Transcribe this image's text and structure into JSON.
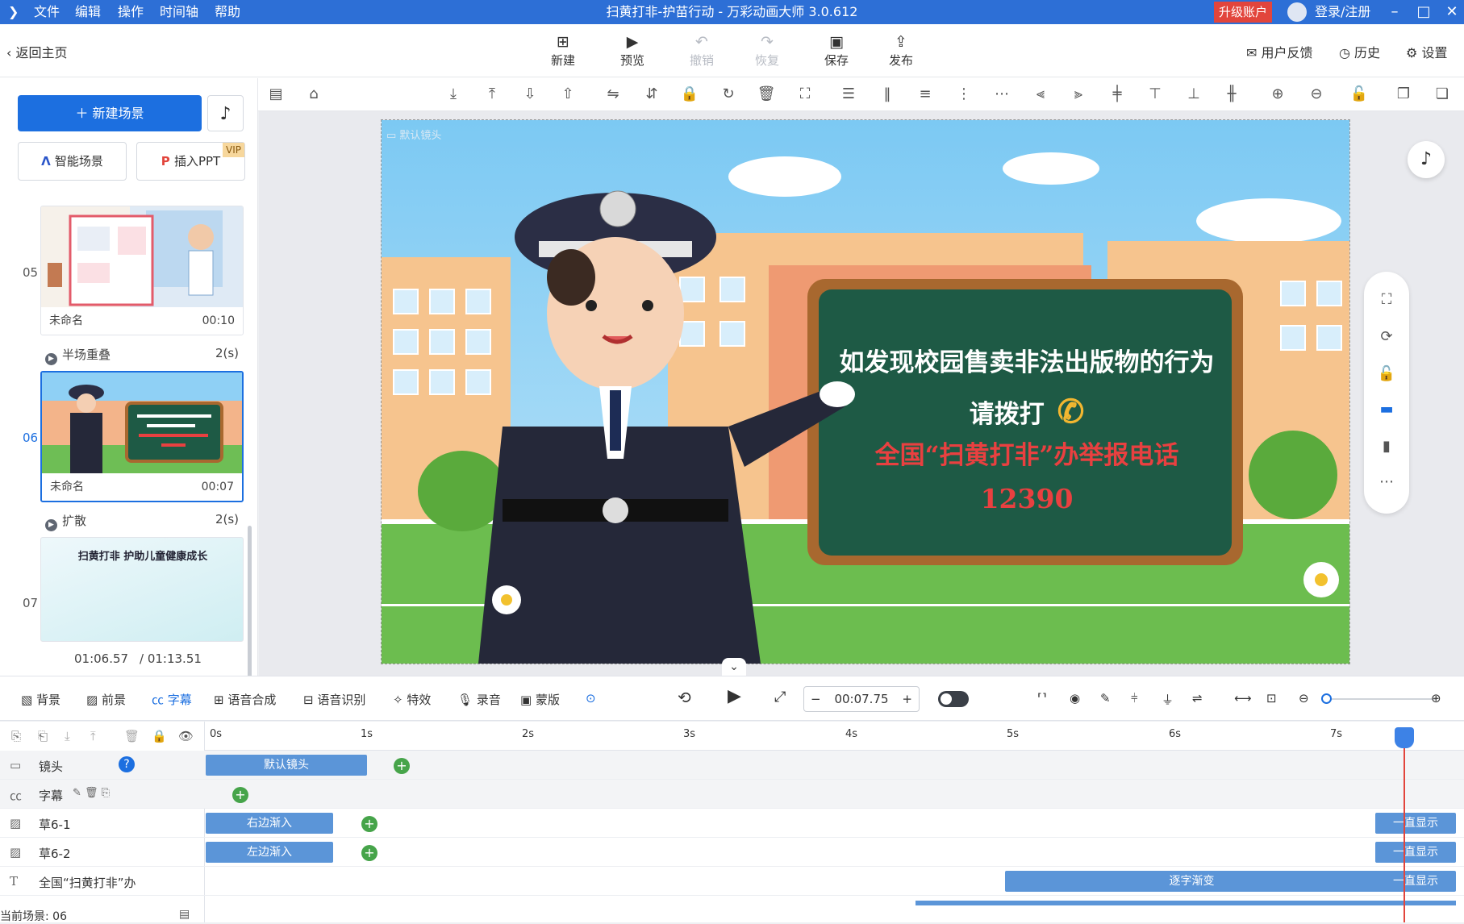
{
  "app": {
    "title": "扫黄打非-护苗行动 - 万彩动画大师 3.0.612",
    "menu": [
      "文件",
      "编辑",
      "操作",
      "时间轴",
      "帮助"
    ],
    "upgrade": "升级账户",
    "login": "登录/注册"
  },
  "toolbar": {
    "back": "返回主页",
    "new": "新建",
    "preview": "预览",
    "undo": "撤销",
    "redo": "恢复",
    "save": "保存",
    "publish": "发布",
    "feedback": "用户反馈",
    "history": "历史",
    "settings": "设置"
  },
  "left": {
    "new_scene": "新建场景",
    "smart_scene": "智能场景",
    "insert_ppt": "插入PPT",
    "vip": "VIP",
    "scenes": [
      {
        "num": "05",
        "name": "未命名",
        "duration": "00:10"
      },
      {
        "num": "06",
        "name": "未命名",
        "duration": "00:07"
      },
      {
        "num": "07",
        "name": "",
        "duration": ""
      }
    ],
    "transitions": [
      {
        "name": "半场重叠",
        "duration": "2(s)"
      },
      {
        "name": "扩散",
        "duration": "2(s)"
      }
    ],
    "scene7_title": "扫黄打非 护助儿童健康成长",
    "current_time": "01:06.57",
    "total_time": "/ 01:13.51"
  },
  "stage": {
    "camera_label": "默认镜头",
    "board_line1": "如发现校园售卖非法出版物的行为",
    "board_line2": "请拨打",
    "board_line3": "全国“扫黄打非”办举报电话",
    "board_line4": "12390"
  },
  "bottom": {
    "tabs": [
      "背景",
      "前景",
      "字幕",
      "语音合成",
      "语音识别",
      "特效",
      "录音",
      "蒙版"
    ],
    "active_tab": "字幕",
    "time": "00:07.75"
  },
  "timeline": {
    "ticks": [
      "0s",
      "1s",
      "2s",
      "3s",
      "4s",
      "5s",
      "6s",
      "7s"
    ],
    "rows": [
      {
        "label": "镜头",
        "clip": "默认镜头"
      },
      {
        "label": "字幕",
        "clip": ""
      },
      {
        "label": "草6-1",
        "clip": "右边渐入",
        "end_clip": "一直显示"
      },
      {
        "label": "草6-2",
        "clip": "左边渐入",
        "end_clip": "一直显示"
      },
      {
        "label": "全国“扫黄打非”办",
        "clip": "逐字渐变",
        "end_clip": "一直显示"
      }
    ],
    "status": "当前场景: 06"
  },
  "colors": {
    "primary": "#1c6fe0",
    "titlebar": "#2d6fd6",
    "board": "#1e5a45",
    "upgrade": "#e2453c"
  }
}
